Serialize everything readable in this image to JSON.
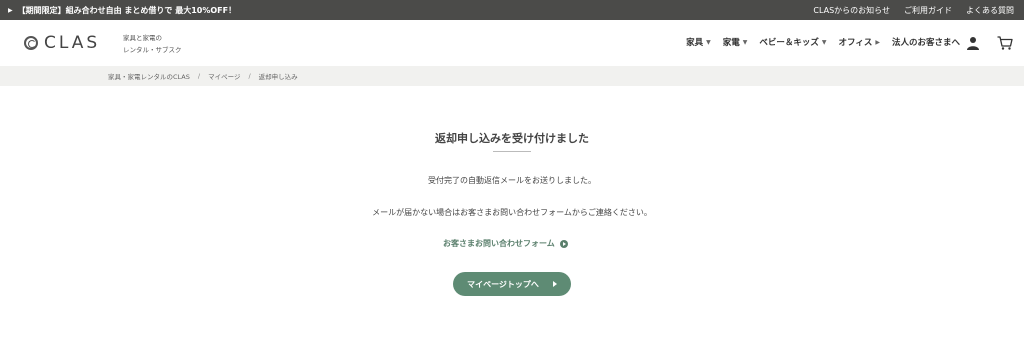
{
  "promo": {
    "text": "【期間限定】組み合わせ自由 まとめ借りで 最大10%OFF！",
    "links": [
      "CLASからのお知らせ",
      "ご利用ガイド",
      "よくある質問"
    ]
  },
  "header": {
    "logo_text": "CLAS",
    "tagline_line1": "家具と家電の",
    "tagline_line2": "レンタル・サブスク",
    "nav": [
      {
        "label": "家具",
        "has_caret": true
      },
      {
        "label": "家電",
        "has_caret": true
      },
      {
        "label": "ベビー＆キッズ",
        "has_caret": true
      },
      {
        "label": "オフィス",
        "has_caret": true
      },
      {
        "label": "法人のお客さまへ",
        "has_caret": false
      }
    ],
    "icons": [
      "user-icon",
      "cart-icon"
    ]
  },
  "breadcrumb": {
    "items": [
      "家具・家電レンタルのCLAS",
      "マイページ",
      "返却申し込み"
    ],
    "separator": "/"
  },
  "main": {
    "title": "返却申し込みを受け付けました",
    "message1": "受付完了の自動返信メールをお送りしました。",
    "message2": "メールが届かない場合はお客さまお問い合わせフォームからご連絡ください。",
    "contact_link": "お客さまお問い合わせフォーム",
    "mypage_button": "マイページトップへ"
  },
  "colors": {
    "promo_bg": "#4b4b49",
    "accent_green": "#5e8b74",
    "link_green": "#5a7f6c",
    "breadcrumb_bg": "#f1f1ef"
  }
}
